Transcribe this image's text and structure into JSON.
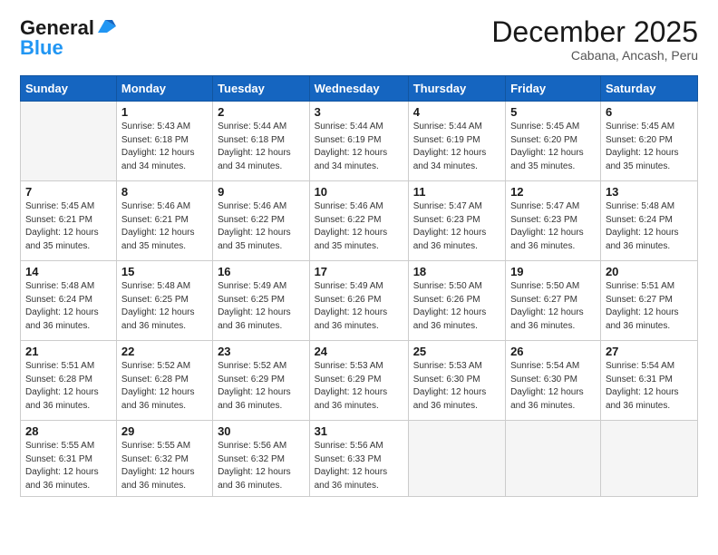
{
  "logo": {
    "line1": "General",
    "line2": "Blue"
  },
  "header": {
    "month_year": "December 2025",
    "location": "Cabana, Ancash, Peru"
  },
  "weekdays": [
    "Sunday",
    "Monday",
    "Tuesday",
    "Wednesday",
    "Thursday",
    "Friday",
    "Saturday"
  ],
  "weeks": [
    [
      {
        "day": "",
        "empty": true
      },
      {
        "day": "1",
        "sunrise": "Sunrise: 5:43 AM",
        "sunset": "Sunset: 6:18 PM",
        "daylight": "Daylight: 12 hours and 34 minutes."
      },
      {
        "day": "2",
        "sunrise": "Sunrise: 5:44 AM",
        "sunset": "Sunset: 6:18 PM",
        "daylight": "Daylight: 12 hours and 34 minutes."
      },
      {
        "day": "3",
        "sunrise": "Sunrise: 5:44 AM",
        "sunset": "Sunset: 6:19 PM",
        "daylight": "Daylight: 12 hours and 34 minutes."
      },
      {
        "day": "4",
        "sunrise": "Sunrise: 5:44 AM",
        "sunset": "Sunset: 6:19 PM",
        "daylight": "Daylight: 12 hours and 34 minutes."
      },
      {
        "day": "5",
        "sunrise": "Sunrise: 5:45 AM",
        "sunset": "Sunset: 6:20 PM",
        "daylight": "Daylight: 12 hours and 35 minutes."
      },
      {
        "day": "6",
        "sunrise": "Sunrise: 5:45 AM",
        "sunset": "Sunset: 6:20 PM",
        "daylight": "Daylight: 12 hours and 35 minutes."
      }
    ],
    [
      {
        "day": "7",
        "sunrise": "Sunrise: 5:45 AM",
        "sunset": "Sunset: 6:21 PM",
        "daylight": "Daylight: 12 hours and 35 minutes."
      },
      {
        "day": "8",
        "sunrise": "Sunrise: 5:46 AM",
        "sunset": "Sunset: 6:21 PM",
        "daylight": "Daylight: 12 hours and 35 minutes."
      },
      {
        "day": "9",
        "sunrise": "Sunrise: 5:46 AM",
        "sunset": "Sunset: 6:22 PM",
        "daylight": "Daylight: 12 hours and 35 minutes."
      },
      {
        "day": "10",
        "sunrise": "Sunrise: 5:46 AM",
        "sunset": "Sunset: 6:22 PM",
        "daylight": "Daylight: 12 hours and 35 minutes."
      },
      {
        "day": "11",
        "sunrise": "Sunrise: 5:47 AM",
        "sunset": "Sunset: 6:23 PM",
        "daylight": "Daylight: 12 hours and 36 minutes."
      },
      {
        "day": "12",
        "sunrise": "Sunrise: 5:47 AM",
        "sunset": "Sunset: 6:23 PM",
        "daylight": "Daylight: 12 hours and 36 minutes."
      },
      {
        "day": "13",
        "sunrise": "Sunrise: 5:48 AM",
        "sunset": "Sunset: 6:24 PM",
        "daylight": "Daylight: 12 hours and 36 minutes."
      }
    ],
    [
      {
        "day": "14",
        "sunrise": "Sunrise: 5:48 AM",
        "sunset": "Sunset: 6:24 PM",
        "daylight": "Daylight: 12 hours and 36 minutes."
      },
      {
        "day": "15",
        "sunrise": "Sunrise: 5:48 AM",
        "sunset": "Sunset: 6:25 PM",
        "daylight": "Daylight: 12 hours and 36 minutes."
      },
      {
        "day": "16",
        "sunrise": "Sunrise: 5:49 AM",
        "sunset": "Sunset: 6:25 PM",
        "daylight": "Daylight: 12 hours and 36 minutes."
      },
      {
        "day": "17",
        "sunrise": "Sunrise: 5:49 AM",
        "sunset": "Sunset: 6:26 PM",
        "daylight": "Daylight: 12 hours and 36 minutes."
      },
      {
        "day": "18",
        "sunrise": "Sunrise: 5:50 AM",
        "sunset": "Sunset: 6:26 PM",
        "daylight": "Daylight: 12 hours and 36 minutes."
      },
      {
        "day": "19",
        "sunrise": "Sunrise: 5:50 AM",
        "sunset": "Sunset: 6:27 PM",
        "daylight": "Daylight: 12 hours and 36 minutes."
      },
      {
        "day": "20",
        "sunrise": "Sunrise: 5:51 AM",
        "sunset": "Sunset: 6:27 PM",
        "daylight": "Daylight: 12 hours and 36 minutes."
      }
    ],
    [
      {
        "day": "21",
        "sunrise": "Sunrise: 5:51 AM",
        "sunset": "Sunset: 6:28 PM",
        "daylight": "Daylight: 12 hours and 36 minutes."
      },
      {
        "day": "22",
        "sunrise": "Sunrise: 5:52 AM",
        "sunset": "Sunset: 6:28 PM",
        "daylight": "Daylight: 12 hours and 36 minutes."
      },
      {
        "day": "23",
        "sunrise": "Sunrise: 5:52 AM",
        "sunset": "Sunset: 6:29 PM",
        "daylight": "Daylight: 12 hours and 36 minutes."
      },
      {
        "day": "24",
        "sunrise": "Sunrise: 5:53 AM",
        "sunset": "Sunset: 6:29 PM",
        "daylight": "Daylight: 12 hours and 36 minutes."
      },
      {
        "day": "25",
        "sunrise": "Sunrise: 5:53 AM",
        "sunset": "Sunset: 6:30 PM",
        "daylight": "Daylight: 12 hours and 36 minutes."
      },
      {
        "day": "26",
        "sunrise": "Sunrise: 5:54 AM",
        "sunset": "Sunset: 6:30 PM",
        "daylight": "Daylight: 12 hours and 36 minutes."
      },
      {
        "day": "27",
        "sunrise": "Sunrise: 5:54 AM",
        "sunset": "Sunset: 6:31 PM",
        "daylight": "Daylight: 12 hours and 36 minutes."
      }
    ],
    [
      {
        "day": "28",
        "sunrise": "Sunrise: 5:55 AM",
        "sunset": "Sunset: 6:31 PM",
        "daylight": "Daylight: 12 hours and 36 minutes."
      },
      {
        "day": "29",
        "sunrise": "Sunrise: 5:55 AM",
        "sunset": "Sunset: 6:32 PM",
        "daylight": "Daylight: 12 hours and 36 minutes."
      },
      {
        "day": "30",
        "sunrise": "Sunrise: 5:56 AM",
        "sunset": "Sunset: 6:32 PM",
        "daylight": "Daylight: 12 hours and 36 minutes."
      },
      {
        "day": "31",
        "sunrise": "Sunrise: 5:56 AM",
        "sunset": "Sunset: 6:33 PM",
        "daylight": "Daylight: 12 hours and 36 minutes."
      },
      {
        "day": "",
        "empty": true
      },
      {
        "day": "",
        "empty": true
      },
      {
        "day": "",
        "empty": true
      }
    ]
  ]
}
